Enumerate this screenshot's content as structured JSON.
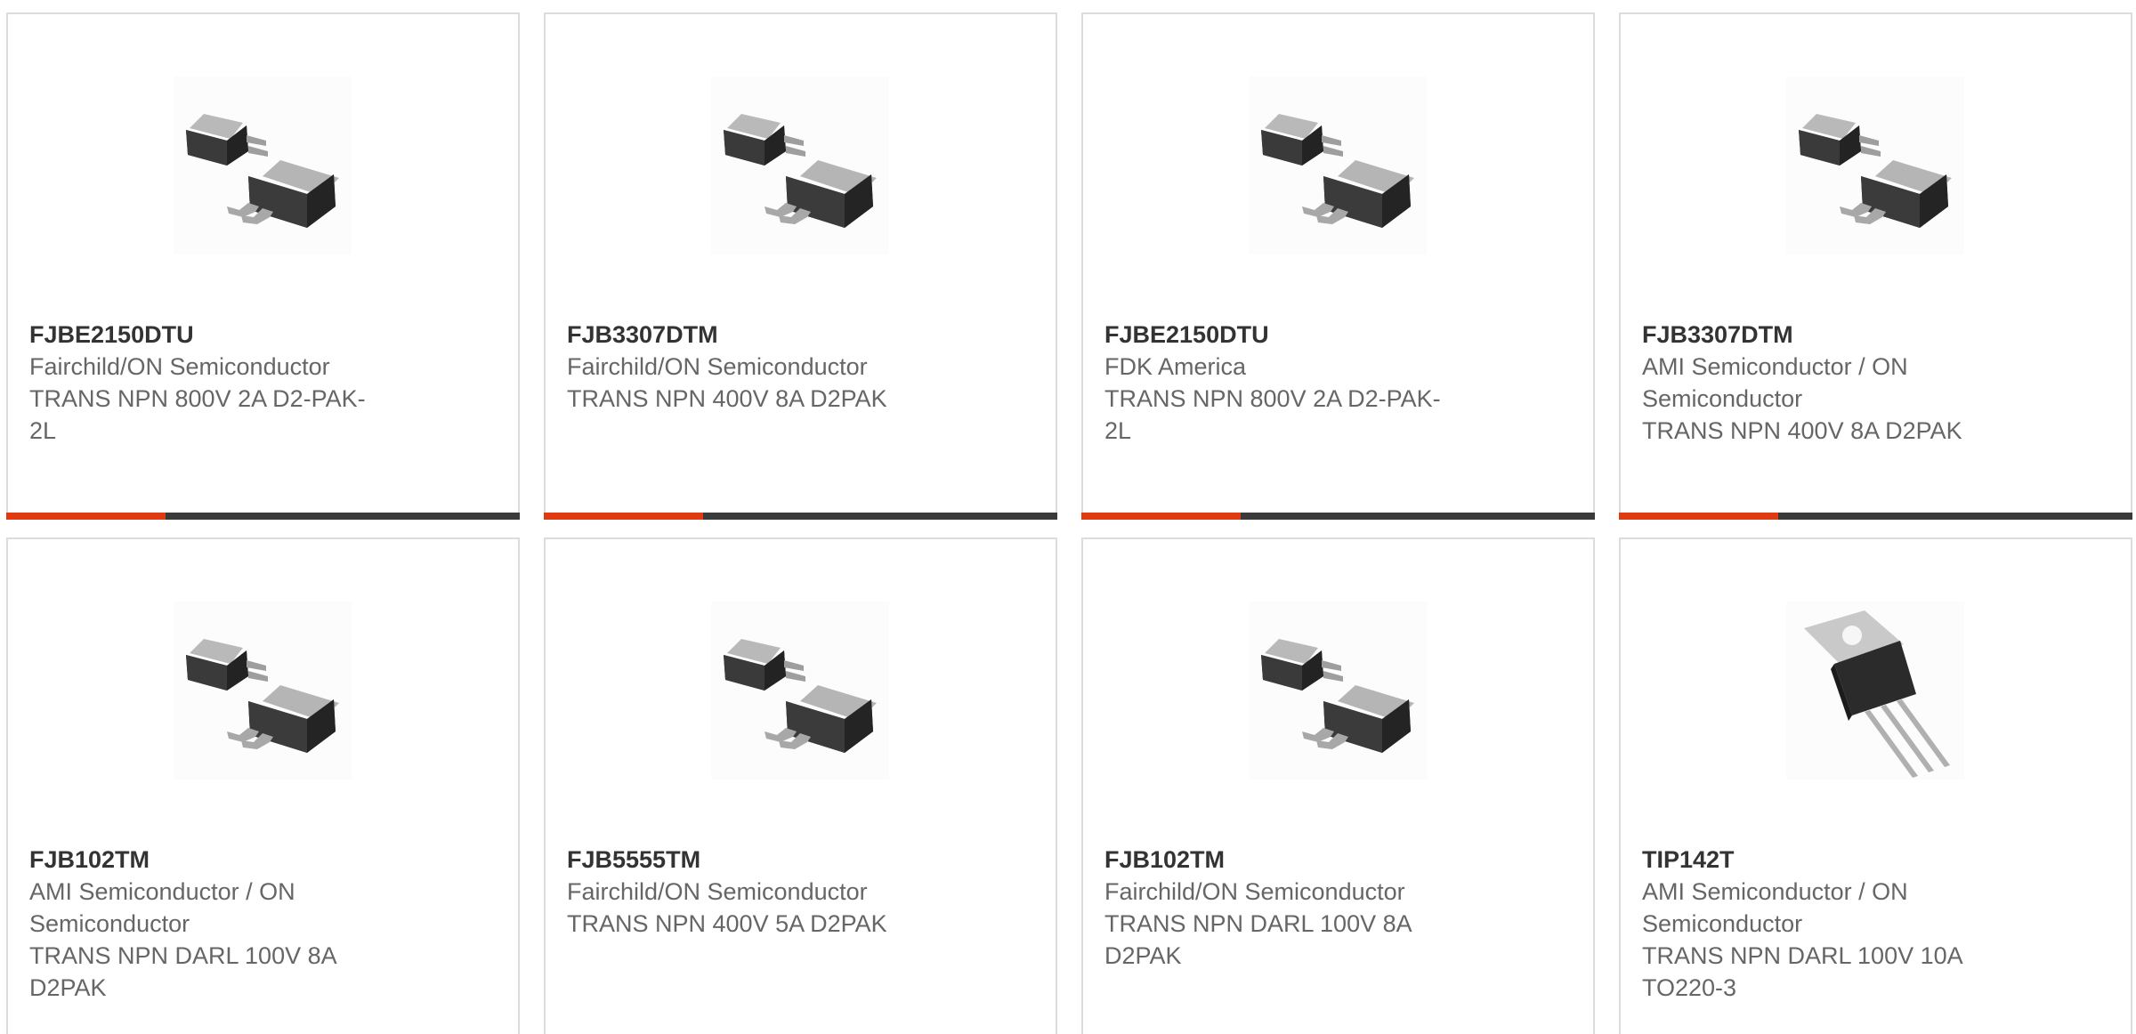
{
  "colors": {
    "accent": "#e03a12",
    "bar_track": "#3a3a3a",
    "card_border": "#dcdcdc",
    "text_bold": "#333333",
    "text": "#666666"
  },
  "cards": [
    {
      "part": "FJBE2150DTU",
      "manufacturer": "Fairchild/ON Semiconductor",
      "description": "TRANS NPN 800V 2A D2-PAK-2L",
      "image_icon": "d2pak-transistor-icon",
      "progress": 0.31
    },
    {
      "part": "FJB3307DTM",
      "manufacturer": "Fairchild/ON Semiconductor",
      "description": "TRANS NPN 400V 8A D2PAK",
      "image_icon": "d2pak-transistor-icon",
      "progress": 0.31
    },
    {
      "part": "FJBE2150DTU",
      "manufacturer": "FDK America",
      "description": "TRANS NPN 800V 2A D2-PAK-2L",
      "image_icon": "d2pak-transistor-icon",
      "progress": 0.31
    },
    {
      "part": "FJB3307DTM",
      "manufacturer": "AMI Semiconductor / ON Semiconductor",
      "description": "TRANS NPN 400V 8A D2PAK",
      "image_icon": "d2pak-transistor-icon",
      "progress": 0.31
    },
    {
      "part": "FJB102TM",
      "manufacturer": "AMI Semiconductor / ON Semiconductor",
      "description": "TRANS NPN DARL 100V 8A D2PAK",
      "image_icon": "d2pak-transistor-icon",
      "progress": null
    },
    {
      "part": "FJB5555TM",
      "manufacturer": "Fairchild/ON Semiconductor",
      "description": "TRANS NPN 400V 5A D2PAK",
      "image_icon": "d2pak-transistor-icon",
      "progress": null
    },
    {
      "part": "FJB102TM",
      "manufacturer": "Fairchild/ON Semiconductor",
      "description": "TRANS NPN DARL 100V 8A D2PAK",
      "image_icon": "d2pak-transistor-icon",
      "progress": null
    },
    {
      "part": "TIP142T",
      "manufacturer": "AMI Semiconductor / ON Semiconductor",
      "description": "TRANS NPN DARL 100V 10A TO220-3",
      "image_icon": "to220-transistor-icon",
      "progress": null
    }
  ]
}
